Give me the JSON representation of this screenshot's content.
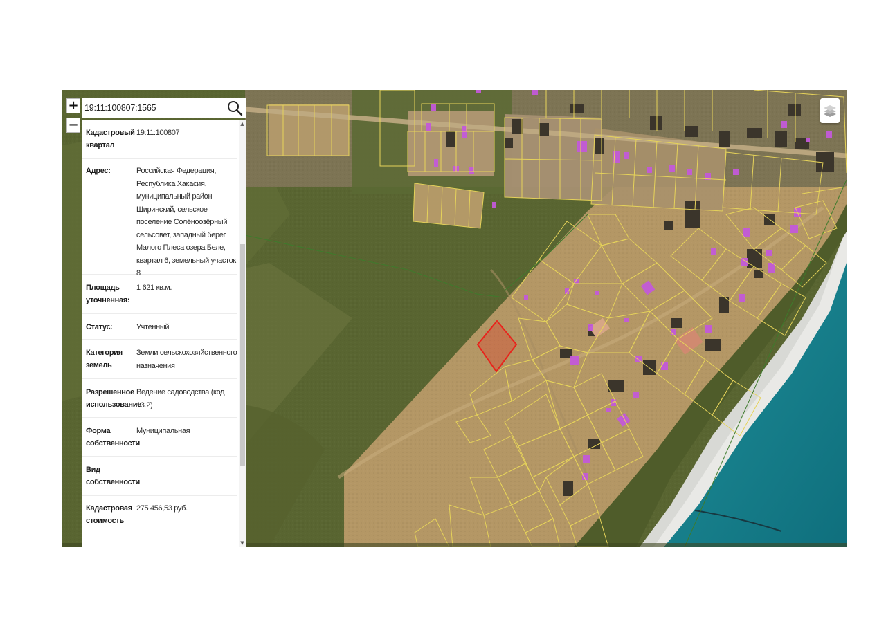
{
  "search": {
    "value": "19:11:100807:1565"
  },
  "zoom": {
    "in_label": "+",
    "out_label": "−"
  },
  "info_rows": [
    {
      "label": "Кадастровый квартал",
      "value": "19:11:100807"
    },
    {
      "label": "Адрес:",
      "value": "Российская Федерация, Республика Хакасия, муниципальный район Ширинский, сельское поселение Солёноозёрный сельсовет, западный берег Малого Плеса озера Беле, квартал 6, земельный участок 8"
    },
    {
      "label": "Площадь уточненная:",
      "value": "1 621 кв.м."
    },
    {
      "label": "Статус:",
      "value": "Учтенный"
    },
    {
      "label": "Категория земель",
      "value": "Земли сельскохозяйственного назначения"
    },
    {
      "label": "Разрешенное использование",
      "value": "Ведение садоводства (код 13.2)"
    },
    {
      "label": "Форма собственности",
      "value": "Муниципальная"
    },
    {
      "label": "Вид собственности",
      "value": ""
    },
    {
      "label": "Кадастровая стоимость",
      "value": "275 456,53 руб."
    }
  ],
  "map": {
    "parcel_outline_color": "#e6d35a",
    "selected_parcel_color": "#e8241c",
    "building_color": "#c35ad8",
    "icons": [
      "search-icon",
      "layers-icon"
    ]
  }
}
